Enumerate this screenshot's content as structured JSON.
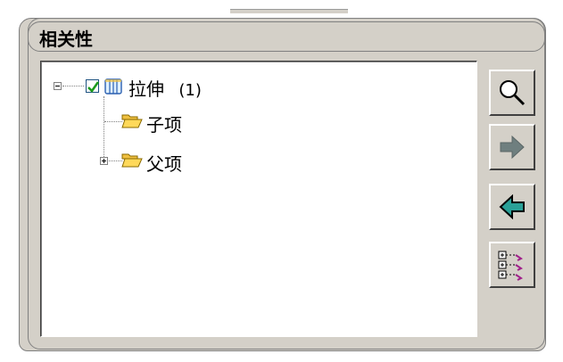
{
  "group": {
    "title": "相关性"
  },
  "tree": {
    "root": {
      "label": "拉伸",
      "count": "(1)",
      "checked": true,
      "icon": "part-cylinder-icon"
    },
    "children": [
      {
        "label": "子项",
        "icon": "folder-open-icon",
        "expandable": false
      },
      {
        "label": "父项",
        "icon": "folder-open-icon",
        "expandable": true
      }
    ]
  },
  "toolbar": {
    "buttons": [
      {
        "name": "search-button",
        "icon": "magnifier-icon"
      },
      {
        "name": "forward-button",
        "icon": "arrow-right-icon",
        "disabled": true
      },
      {
        "name": "back-button",
        "icon": "arrow-left-icon"
      },
      {
        "name": "expand-tree-button",
        "icon": "tree-expand-icon"
      }
    ]
  },
  "colors": {
    "panel": "#d4d0c8",
    "folder": "#f0c040",
    "check": "#1c9a1c",
    "teal_arrow": "#2aa198",
    "gray_arrow": "#6f7f7f"
  }
}
